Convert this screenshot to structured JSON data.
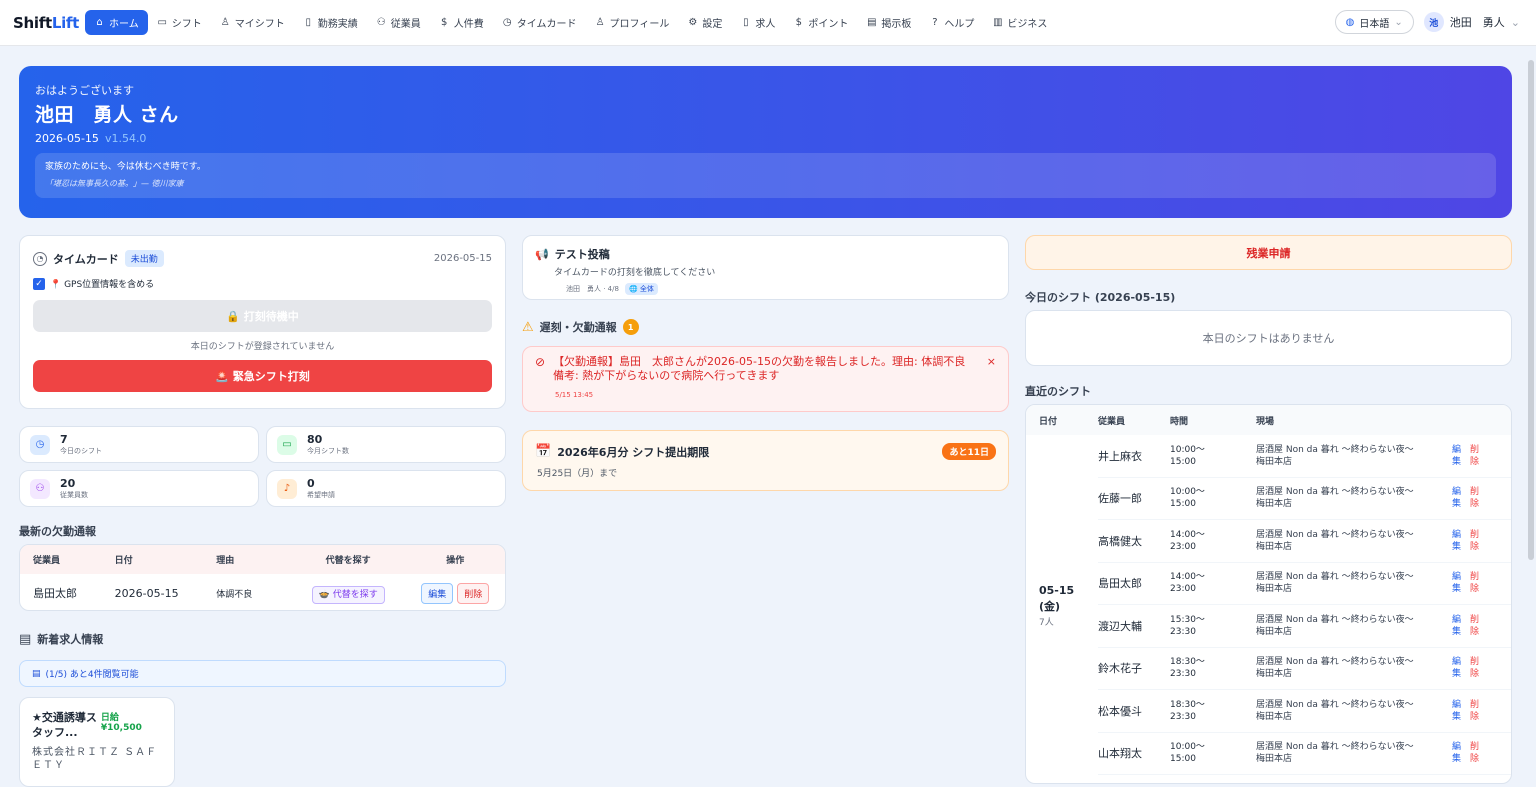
{
  "nav": {
    "logo_a": "Shift",
    "logo_b": "Lift",
    "items": [
      {
        "label": "ホーム",
        "icon": "home-icon",
        "glyph": "⌂"
      },
      {
        "label": "シフト",
        "icon": "calendar-icon",
        "glyph": "▭"
      },
      {
        "label": "マイシフト",
        "icon": "person-icon",
        "glyph": "♙"
      },
      {
        "label": "勤務実績",
        "icon": "document-icon",
        "glyph": "▯"
      },
      {
        "label": "従業員",
        "icon": "users-icon",
        "glyph": "⚇"
      },
      {
        "label": "人件費",
        "icon": "dollar-icon",
        "glyph": "$"
      },
      {
        "label": "タイムカード",
        "icon": "clock-icon",
        "glyph": "◷"
      },
      {
        "label": "プロフィール",
        "icon": "profile-icon",
        "glyph": "♙"
      },
      {
        "label": "設定",
        "icon": "gear-icon",
        "glyph": "⚙"
      },
      {
        "label": "求人",
        "icon": "file-icon",
        "glyph": "▯"
      },
      {
        "label": "ポイント",
        "icon": "coin-icon",
        "glyph": "$"
      },
      {
        "label": "掲示板",
        "icon": "clipboard-icon",
        "glyph": "▤"
      },
      {
        "label": "ヘルプ",
        "icon": "help-icon",
        "glyph": "?"
      },
      {
        "label": "ビジネス",
        "icon": "building-icon",
        "glyph": "▥"
      }
    ],
    "language": "日本語",
    "user_initial": "池",
    "user_name": "池田　勇人"
  },
  "hero": {
    "greeting": "おはようございます",
    "name": "池田　勇人 さん",
    "date": "2026-05-15",
    "version": "v1.54.0",
    "quote": "家族のためにも、今は休むべき時です。",
    "quote_source": "「堪忍は無事長久の基。」— 徳川家康"
  },
  "timecard": {
    "title": "タイムカード",
    "status": "未出勤",
    "date": "2026-05-15",
    "gps_label": "📍 GPS位置情報を含める",
    "wait_button": "🔒 打刻待機中",
    "no_shift": "本日のシフトが登録されていません",
    "emergency_button": "🚨 緊急シフト打刻"
  },
  "stats": [
    {
      "value": "7",
      "label": "今日のシフト",
      "glyph": "◷",
      "icon": "clock-icon",
      "bg": "#dbeafe",
      "fg": "#2563eb"
    },
    {
      "value": "80",
      "label": "今月シフト数",
      "glyph": "▭",
      "icon": "calendar-icon",
      "bg": "#dcfce7",
      "fg": "#16a34a"
    },
    {
      "value": "20",
      "label": "従業員数",
      "glyph": "⚇",
      "icon": "users-icon",
      "bg": "#f3e8ff",
      "fg": "#9333ea"
    },
    {
      "value": "0",
      "label": "希望申請",
      "glyph": "♪",
      "icon": "bell-icon",
      "bg": "#ffedd5",
      "fg": "#ea580c"
    }
  ],
  "absence": {
    "title": "最新の欠勤通報",
    "headers": [
      "従業員",
      "日付",
      "理由",
      "代替を探す",
      "操作"
    ],
    "row": {
      "name": "島田太郎",
      "date": "2026-05-15",
      "reason": "体調不良",
      "find": "🍲 代替を探す",
      "edit": "編集",
      "delete": "削除"
    }
  },
  "jobs": {
    "title": "新着求人情報",
    "bar": "(1/5) あと4件閲覧可能",
    "card_title": "★交通誘導スタッフ...",
    "pay": "日給 ¥10,500",
    "company": "株式会社ＲＩＴＺ ＳＡＦＥＴＹ"
  },
  "post": {
    "title": "テスト投稿",
    "body": "タイムカードの打刻を徹底してください",
    "meta": "池田　勇人 · 4/8",
    "scope": "🌐 全体"
  },
  "late": {
    "title": "遅刻・欠勤通報",
    "count": "1",
    "message": "【欠勤通報】島田　太郎さんが2026-05-15の欠勤を報告しました。理由: 体調不良 備考: 熱が下がらないので病院へ行ってきます",
    "time": "5/15 13:45",
    "close": "×"
  },
  "deadline": {
    "title": "2026年6月分 シフト提出期限",
    "badge": "あと11日",
    "sub": "5月25日（月）まで"
  },
  "overtime": {
    "label": "残業申請"
  },
  "today_shift": {
    "title": "今日のシフト (2026-05-15)",
    "empty": "本日のシフトはありません"
  },
  "recent": {
    "title": "直近のシフト",
    "headers": [
      "日付",
      "従業員",
      "時間",
      "現場"
    ],
    "date": "05-15\n(金)",
    "date_line1": "05-15",
    "date_line2": "(金)",
    "count": "7人",
    "edit_line1": "編",
    "edit_line2": "集",
    "delete_line1": "削",
    "delete_line2": "除",
    "rows": [
      {
        "name": "井上麻衣",
        "start": "10:00〜",
        "end": "15:00",
        "site1": "居酒屋 Non da 暮れ 〜終わらない夜〜",
        "site2": "梅田本店"
      },
      {
        "name": "佐藤一郎",
        "start": "10:00〜",
        "end": "15:00",
        "site1": "居酒屋 Non da 暮れ 〜終わらない夜〜",
        "site2": "梅田本店"
      },
      {
        "name": "高橋健太",
        "start": "14:00〜",
        "end": "23:00",
        "site1": "居酒屋 Non da 暮れ 〜終わらない夜〜",
        "site2": "梅田本店"
      },
      {
        "name": "島田太郎",
        "start": "14:00〜",
        "end": "23:00",
        "site1": "居酒屋 Non da 暮れ 〜終わらない夜〜",
        "site2": "梅田本店"
      },
      {
        "name": "渡辺大輔",
        "start": "15:30〜",
        "end": "23:30",
        "site1": "居酒屋 Non da 暮れ 〜終わらない夜〜",
        "site2": "梅田本店"
      },
      {
        "name": "鈴木花子",
        "start": "18:30〜",
        "end": "23:30",
        "site1": "居酒屋 Non da 暮れ 〜終わらない夜〜",
        "site2": "梅田本店"
      },
      {
        "name": "松本優斗",
        "start": "18:30〜",
        "end": "23:30",
        "site1": "居酒屋 Non da 暮れ 〜終わらない夜〜",
        "site2": "梅田本店"
      },
      {
        "name": "山本翔太",
        "start": "10:00〜",
        "end": "15:00",
        "site1": "居酒屋 Non da 暮れ 〜終わらない夜〜",
        "site2": "梅田本店"
      }
    ]
  }
}
